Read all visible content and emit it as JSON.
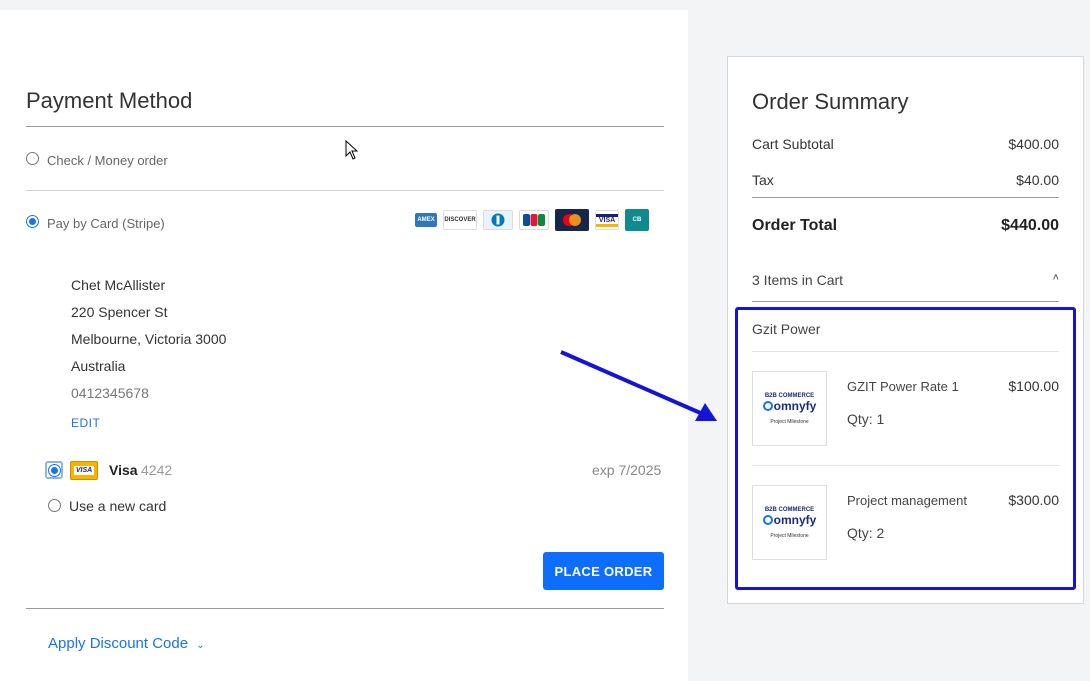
{
  "payment": {
    "title": "Payment Method",
    "options": {
      "check_label": "Check / Money order",
      "card_label": "Pay by Card (Stripe)"
    },
    "card_brands": [
      {
        "name": "AMEX",
        "color": "#2e77bb"
      },
      {
        "name": "DISCOVER",
        "color": "#f57c00"
      },
      {
        "name": "DINERS",
        "color": "#0079be"
      },
      {
        "name": "JCB",
        "color": "#0b8a3e"
      },
      {
        "name": "MASTERCARD",
        "color": "#eb001b"
      },
      {
        "name": "VISA",
        "color": "#1a1f71"
      },
      {
        "name": "CB",
        "color": "#0f8b8d"
      }
    ],
    "address": {
      "name": "Chet McAllister",
      "street": "220 Spencer St",
      "city": "Melbourne, Victoria 3000",
      "country": "Australia",
      "phone": "0412345678",
      "edit_label": "EDIT"
    },
    "saved_card": {
      "badge": "VISA",
      "brand": "Visa",
      "last4": "4242",
      "expiry": "exp 7/2025"
    },
    "new_card_label": "Use a new card",
    "place_order_label": "PLACE ORDER",
    "discount_label": "Apply Discount Code"
  },
  "summary": {
    "title": "Order Summary",
    "subtotal_label": "Cart Subtotal",
    "subtotal_value": "$400.00",
    "tax_label": "Tax",
    "tax_value": "$40.00",
    "total_label": "Order Total",
    "total_value": "$440.00",
    "items_label": "3 Items in Cart",
    "vendor": "Gzit Power",
    "products": [
      {
        "name": "GZIT Power Rate 1",
        "price": "$100.00",
        "qty": "Qty: 1",
        "thumb": {
          "line1": "B2B COMMERCE",
          "brand": "omnyfy",
          "line3": "Project Milestone"
        }
      },
      {
        "name": "Project management",
        "price": "$300.00",
        "qty": "Qty: 2",
        "thumb": {
          "line1": "B2B COMMERCE",
          "brand": "omnyfy",
          "line3": "Project Milestone"
        }
      }
    ]
  },
  "colors": {
    "accent": "#1a73e8",
    "button": "#0d6efd",
    "highlight_box": "#1414d8"
  }
}
